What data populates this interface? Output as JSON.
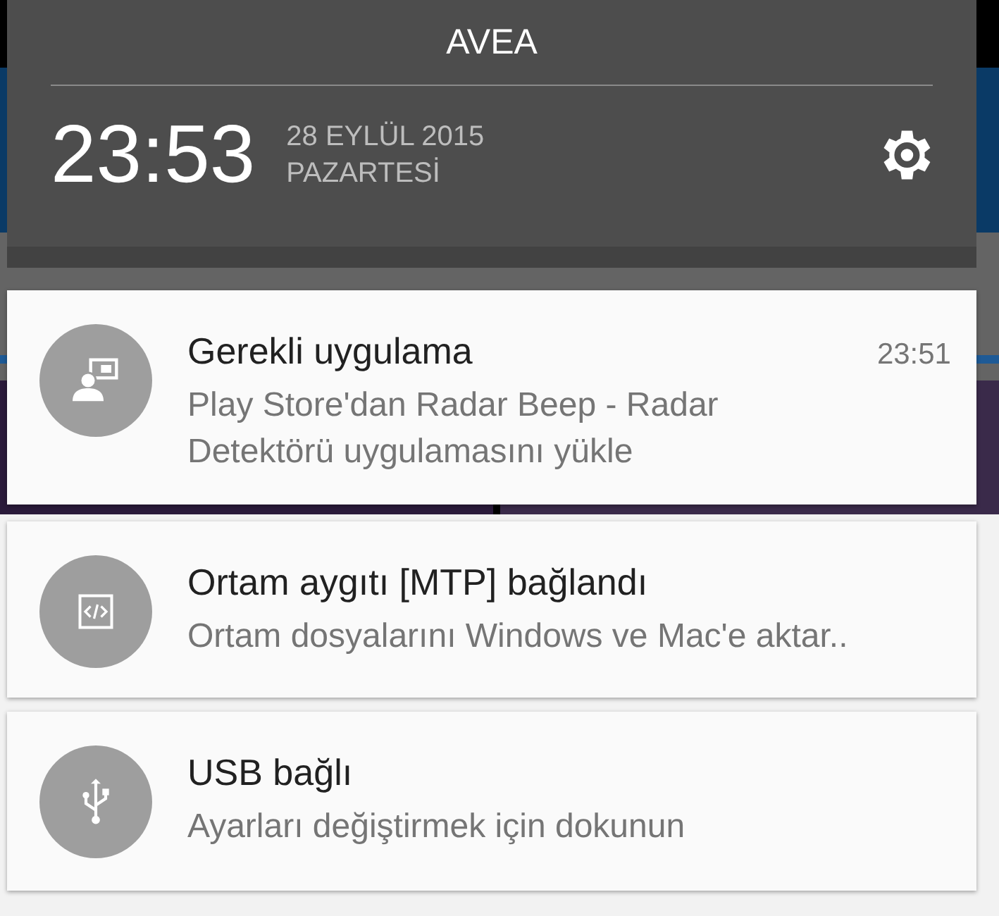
{
  "status_bar": {
    "carrier": "AVEA"
  },
  "header": {
    "time": "23:53",
    "date": "28 EYLÜL 2015",
    "weekday": "PAZARTESİ"
  },
  "notifications": [
    {
      "kind": "app",
      "title": "Gerekli uygulama",
      "time": "23:51",
      "text": "Play Store'dan Radar Beep - Radar Detektörü uygulamasını yükle"
    },
    {
      "kind": "code",
      "title": "Ortam aygıtı [MTP] bağlandı",
      "text": "Ortam dosyalarını Windows ve Mac'e aktar.."
    },
    {
      "kind": "usb",
      "title": "USB bağlı",
      "text": "Ayarları değiştirmek için dokunun"
    }
  ]
}
